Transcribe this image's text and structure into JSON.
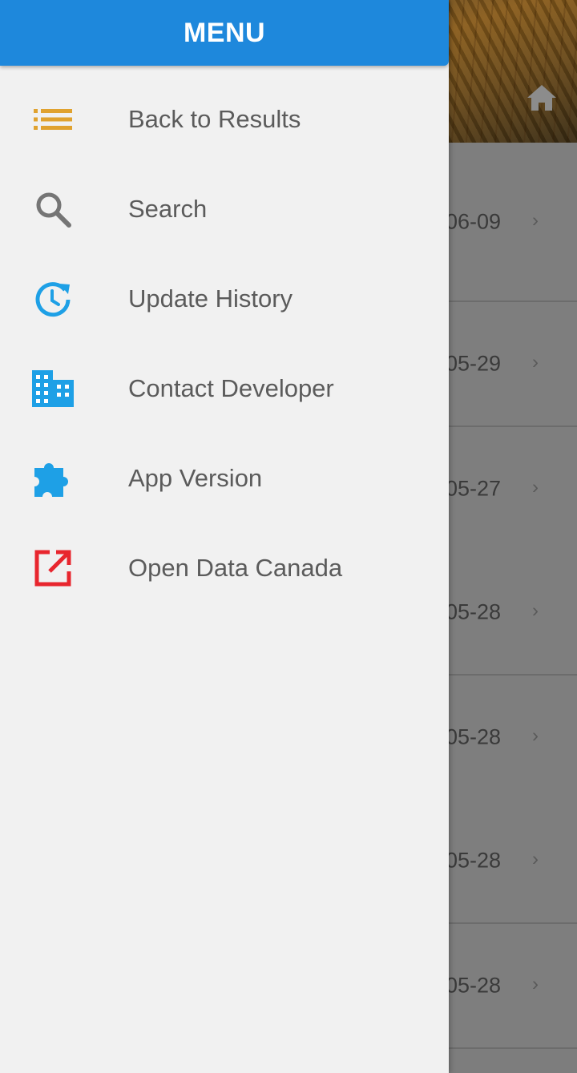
{
  "drawer": {
    "title": "MENU",
    "items": [
      {
        "label": "Back to Results",
        "icon": "list-icon",
        "color": "#e0a22f"
      },
      {
        "label": "Search",
        "icon": "search-icon",
        "color": "#757575"
      },
      {
        "label": "Update History",
        "icon": "history-icon",
        "color": "#1ea0e6"
      },
      {
        "label": "Contact Developer",
        "icon": "building-icon",
        "color": "#1ea0e6"
      },
      {
        "label": "App Version",
        "icon": "puzzle-icon",
        "color": "#1ea0e6"
      },
      {
        "label": "Open Data Canada",
        "icon": "external-link-icon",
        "color": "#e8262e"
      }
    ]
  },
  "background": {
    "home_icon": "home-icon",
    "rows": [
      {
        "date": "06-09"
      },
      {
        "date": "05-29"
      },
      {
        "date": "05-27"
      },
      {
        "date": "05-28"
      },
      {
        "date": "05-28"
      },
      {
        "date": "05-28"
      },
      {
        "date": "05-28"
      }
    ]
  },
  "colors": {
    "header_blue": "#1e88dc",
    "drawer_bg": "#f1f1f1",
    "scrim": "#7e7e7e"
  }
}
